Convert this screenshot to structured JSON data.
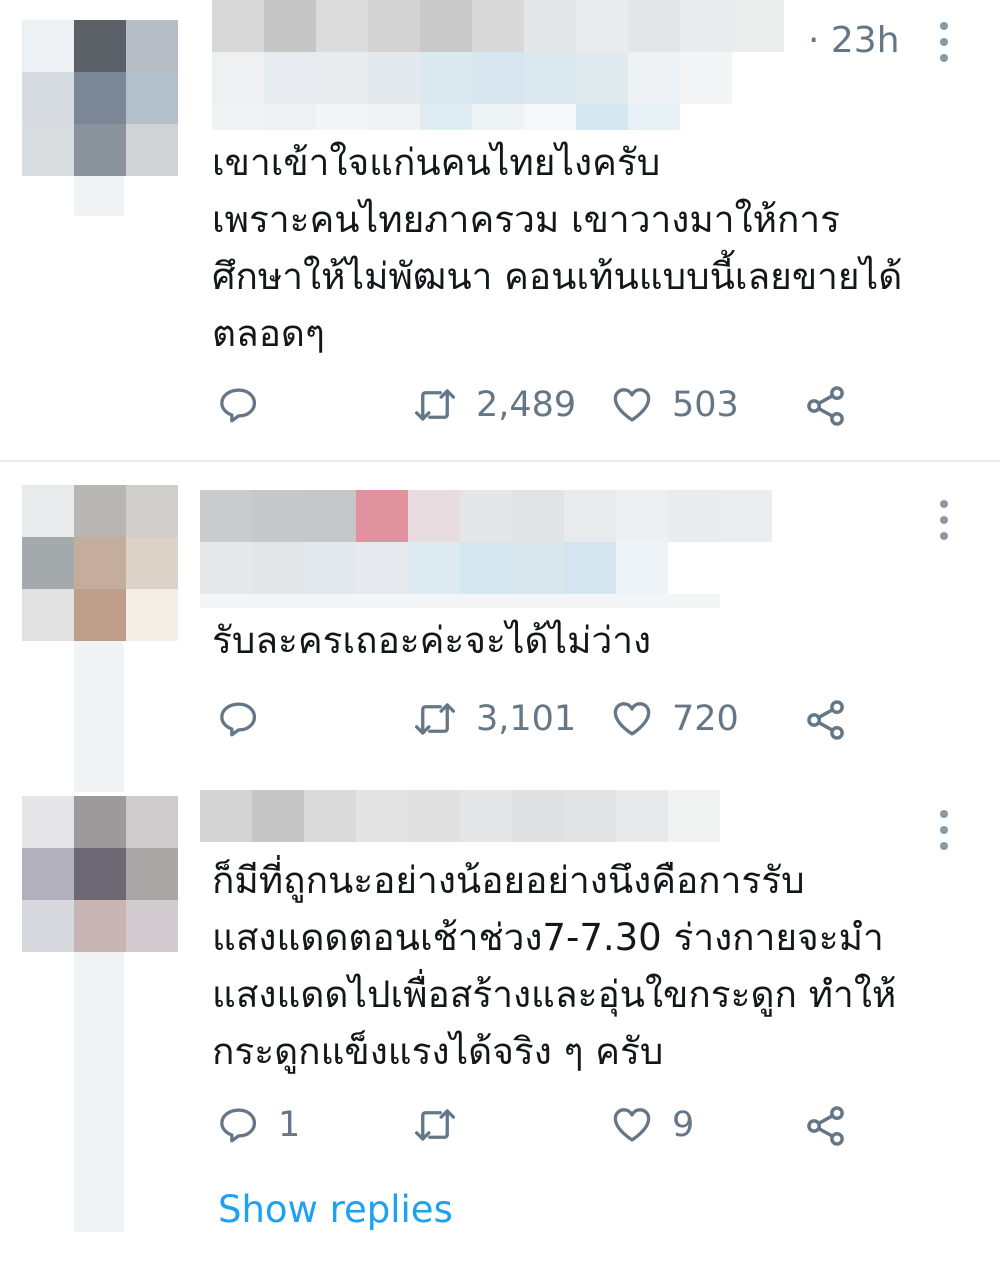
{
  "tweets": [
    {
      "timestamp": "· 23h",
      "text": "เขาเข้าใจแก่นคนไทยไงครับ\nเพราะคนไทยภาครวม เขาวางมาให้การ\nศึกษาให้ไม่พัฒนา คอนเท้นแบบนี้เลยขายได้\nตลอดๆ",
      "reply_count": "",
      "retweet_count": "2,489",
      "like_count": "503"
    },
    {
      "timestamp": "",
      "text": "รับละครเถอะค่ะจะได้ไม่ว่าง",
      "reply_count": "",
      "retweet_count": "3,101",
      "like_count": "720"
    },
    {
      "timestamp": "",
      "text": "ก็มีที่ถูกนะอย่างน้อยอย่างนึงคือการรับ\nแสงแดดตอนเช้าช่วง7-7.30 ร่างกายจะมำ\nแสงแดดไปเพื่อสร้างและอุ่นใขกระดูก ทำให้\nกระดูกแข็งแรงได้จริง ๆ ครับ",
      "reply_count": "1",
      "retweet_count": "",
      "like_count": "9"
    }
  ],
  "show_replies_label": "Show replies",
  "icons": {
    "reply": "reply-icon",
    "retweet": "retweet-icon",
    "like": "heart-icon",
    "share": "share-icon",
    "more": "more-options-icon"
  },
  "colors": {
    "text": "#14171a",
    "muted": "#657786",
    "link": "#1da1f2",
    "divider": "#e6ecf0"
  }
}
